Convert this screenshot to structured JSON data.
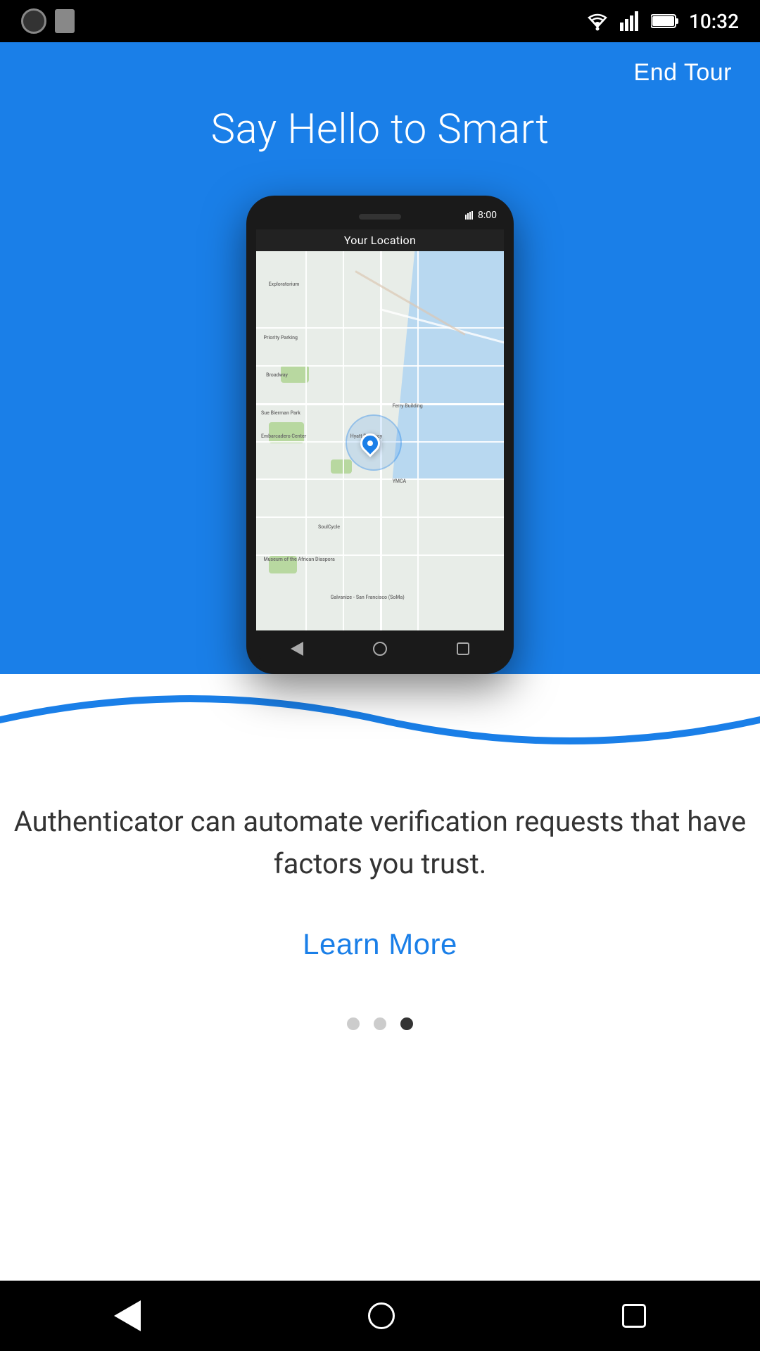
{
  "statusBar": {
    "time": "10:32",
    "icons": [
      "camera",
      "sd-card",
      "wifi",
      "signal",
      "battery"
    ]
  },
  "header": {
    "endTourLabel": "End Tour",
    "titleLine1": "Say Hello to Smart"
  },
  "phone": {
    "statusText": "8:00",
    "screenTitle": "Your Location",
    "locationLabel": "Your Location"
  },
  "content": {
    "description": "Authenticator can automate verification requests that have factors you trust.",
    "learnMoreLabel": "Learn More"
  },
  "pagination": {
    "dots": [
      {
        "active": false,
        "index": 0
      },
      {
        "active": false,
        "index": 1
      },
      {
        "active": true,
        "index": 2
      }
    ]
  },
  "colors": {
    "blue": "#1a7fe8",
    "white": "#ffffff",
    "black": "#000000",
    "textDark": "#2c3e50"
  }
}
